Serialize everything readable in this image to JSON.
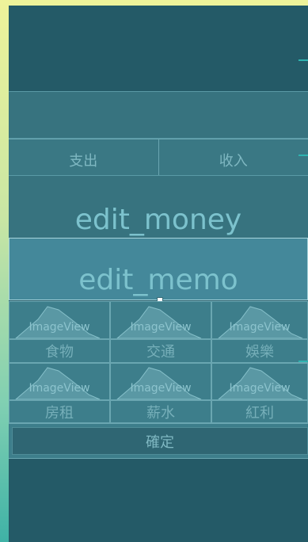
{
  "tabs": {
    "expense": "支出",
    "income": "收入"
  },
  "edit_money": {
    "text": "edit_money"
  },
  "edit_memo": {
    "text": "edit_memo"
  },
  "image_view_label": "ImageView",
  "categories": [
    "食物",
    "交通",
    "娛樂",
    "房租",
    "薪水",
    "紅利"
  ],
  "confirm_button": "確定"
}
